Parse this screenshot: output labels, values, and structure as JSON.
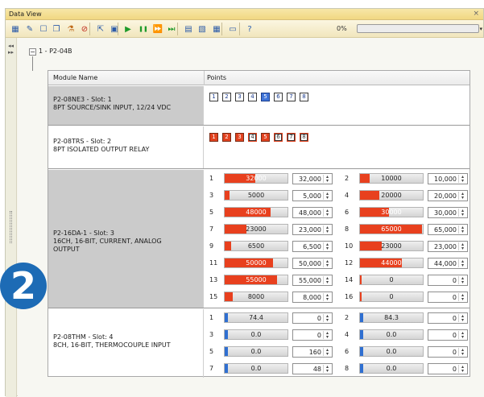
{
  "window": {
    "title": "Data View",
    "close": "×"
  },
  "toolbar": {
    "icons": [
      "grid-icon",
      "wand-icon",
      "select-icon",
      "copy-icon",
      "flask-icon",
      "stop-icon",
      "export-icon",
      "save-icon",
      "play-icon",
      "pause-icon",
      "fast-forward-icon",
      "step-icon",
      "table-icon",
      "chart-icon",
      "grid2-icon",
      "monitor-icon",
      "help-icon"
    ],
    "percent": "0%",
    "progress": 0
  },
  "tree": {
    "node": "1 - P2-04B",
    "expander": "−"
  },
  "grid": {
    "col_module": "Module Name",
    "col_points": "Points"
  },
  "modules": [
    {
      "line1": "P2-08NE3 - Slot: 1",
      "line2": "8PT SOURCE/SINK INPUT, 12/24 VDC",
      "points": [
        "1",
        "2",
        "3",
        "4",
        "5",
        "6",
        "7",
        "8"
      ],
      "on_points": [
        5
      ]
    },
    {
      "line1": "P2-08TRS - Slot: 2",
      "line2": "8PT ISOLATED OUTPUT RELAY",
      "points": [
        "1",
        "2",
        "3",
        "4",
        "5",
        "6",
        "7",
        "8"
      ],
      "on_points": [
        1,
        2,
        3,
        5
      ]
    },
    {
      "line1": "P2-16DA-1 - Slot: 3",
      "line2": "16CH, 16-BIT, CURRENT, ANALOG",
      "line3": "OUTPUT",
      "channels": [
        {
          "n": "1",
          "bar": "32000",
          "value": "32,000"
        },
        {
          "n": "2",
          "bar": "10000",
          "value": "10,000"
        },
        {
          "n": "3",
          "bar": "5000",
          "value": "5,000"
        },
        {
          "n": "4",
          "bar": "20000",
          "value": "20,000"
        },
        {
          "n": "5",
          "bar": "48000",
          "value": "48,000"
        },
        {
          "n": "6",
          "bar": "30000",
          "value": "30,000"
        },
        {
          "n": "7",
          "bar": "23000",
          "value": "23,000"
        },
        {
          "n": "8",
          "bar": "65000",
          "value": "65,000"
        },
        {
          "n": "9",
          "bar": "6500",
          "value": "6,500"
        },
        {
          "n": "10",
          "bar": "23000",
          "value": "23,000"
        },
        {
          "n": "11",
          "bar": "50000",
          "value": "50,000"
        },
        {
          "n": "12",
          "bar": "44000",
          "value": "44,000"
        },
        {
          "n": "13",
          "bar": "55000",
          "value": "55,000"
        },
        {
          "n": "14",
          "bar": "0",
          "value": "0"
        },
        {
          "n": "15",
          "bar": "8000",
          "value": "8,000"
        },
        {
          "n": "16",
          "bar": "0",
          "value": "0"
        }
      ],
      "max": 65535
    },
    {
      "line1": "P2-08THM - Slot: 4",
      "line2": "8CH, 16-BIT, THERMOCOUPLE INPUT",
      "channels": [
        {
          "n": "1",
          "bar": "74.4",
          "value": "0"
        },
        {
          "n": "2",
          "bar": "84.3",
          "value": "0"
        },
        {
          "n": "3",
          "bar": "0.0",
          "value": "0"
        },
        {
          "n": "4",
          "bar": "0.0",
          "value": "0"
        },
        {
          "n": "5",
          "bar": "0.0",
          "value": "160"
        },
        {
          "n": "6",
          "bar": "0.0",
          "value": "0"
        },
        {
          "n": "7",
          "bar": "0.0",
          "value": "48"
        },
        {
          "n": "8",
          "bar": "0.0",
          "value": "0"
        }
      ]
    }
  ],
  "callout": "2",
  "colors": {
    "analog_fill": "#e8401e",
    "thermo_fill": "#2f6fd1",
    "row_gray": "#cbcbcb",
    "title_bar": "#f1d782"
  }
}
